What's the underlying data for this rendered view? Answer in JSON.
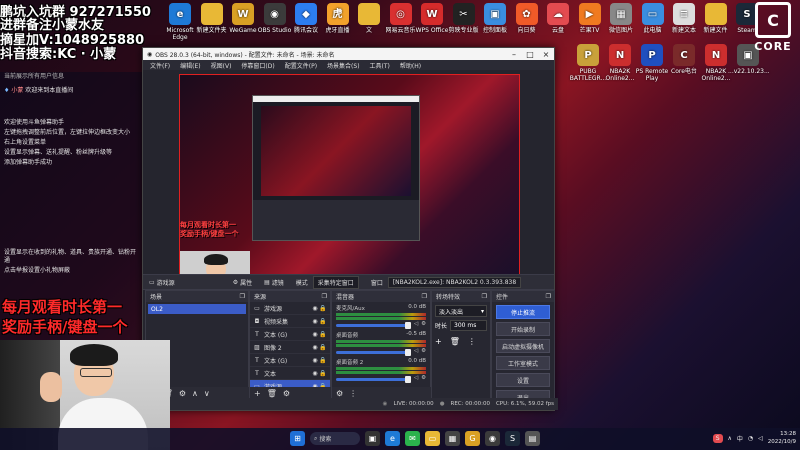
{
  "overlay": {
    "line1": "鹏坑入坑群 927271550",
    "line2": "进群备注小蒙水友",
    "line3": "摘星加V:1048925880",
    "line4": "抖音搜索:KC · 小蒙",
    "banner1": "每月观看时长第一",
    "banner2": "奖励手柄/键盘一个"
  },
  "chat": {
    "header": "当前展示所有用户信息",
    "welcome_user": "小蒙",
    "welcome_text": "欢迎来到本直播间",
    "lines": [
      "欢迎使用斗鱼弹幕助手",
      "左键拖拽调整前后位置，左键拉伸边框改变大小",
      "右上角设置菜单",
      "设置显示弹幕、送礼提醒、粉丝牌升级等",
      "添加弹幕助手成功"
    ],
    "lines2": [
      "设置显示在收到的礼物、道具、贵族开通、钻粉开通",
      "点击举报设置小礼物屏蔽"
    ]
  },
  "desktop_icons": [
    {
      "label": "Microsoft Edge",
      "icon": "edge-icon",
      "color": "#1e7ad6",
      "glyph": "e"
    },
    {
      "label": "新建文件夹",
      "icon": "folder-icon",
      "color": "#e8b836",
      "glyph": ""
    },
    {
      "label": "WeGame",
      "icon": "wegame-icon",
      "color": "#d9a024",
      "glyph": "W"
    },
    {
      "label": "OBS Studio",
      "icon": "obs-icon",
      "color": "#3b3b3b",
      "glyph": "◉"
    },
    {
      "label": "腾讯会议",
      "icon": "meeting-icon",
      "color": "#2c7df0",
      "glyph": "◆"
    },
    {
      "label": "虎牙直播",
      "icon": "huya-icon",
      "color": "#f2a22b",
      "glyph": "虎"
    },
    {
      "label": "文",
      "icon": "folder-icon",
      "color": "#e8b836",
      "glyph": ""
    },
    {
      "label": "网易云音乐",
      "icon": "music-icon",
      "color": "#d93030",
      "glyph": "◎"
    },
    {
      "label": "WPS Office",
      "icon": "wps-icon",
      "color": "#d62b2b",
      "glyph": "W"
    },
    {
      "label": "剪映专业版",
      "icon": "capcut-icon",
      "color": "#222222",
      "glyph": "✂"
    },
    {
      "label": "控制面板",
      "icon": "control-panel-icon",
      "color": "#3a8ee0",
      "glyph": "▣"
    },
    {
      "label": "向日葵",
      "icon": "sunflower-icon",
      "color": "#f05a28",
      "glyph": "✿"
    },
    {
      "label": "云盘",
      "icon": "cloud-icon",
      "color": "#e34b50",
      "glyph": "☁"
    },
    {
      "label": "芒果TV",
      "icon": "mango-icon",
      "color": "#f07a20",
      "glyph": "▶"
    },
    {
      "label": "微信图片",
      "icon": "image-icon",
      "color": "#888888",
      "glyph": "▦"
    },
    {
      "label": "此电脑",
      "icon": "computer-icon",
      "color": "#3a8ee0",
      "glyph": "▭"
    },
    {
      "label": "新建文本",
      "icon": "text-file-icon",
      "color": "#dddddd",
      "glyph": "≡"
    },
    {
      "label": "新建文件",
      "icon": "folder-icon",
      "color": "#e8b836",
      "glyph": ""
    },
    {
      "label": "Steam",
      "icon": "steam-icon",
      "color": "#1b2838",
      "glyph": "S"
    }
  ],
  "desktop_icons_row2": [
    {
      "label": "PUBG BATTLEGR...",
      "icon": "pubg-icon",
      "color": "#c9a13a",
      "glyph": "P"
    },
    {
      "label": "NBA2K Online2...",
      "icon": "nba-icon",
      "color": "#cc2e2e",
      "glyph": "N"
    },
    {
      "label": "PS Remote Play",
      "icon": "ps-icon",
      "color": "#1f4fbf",
      "glyph": "P"
    },
    {
      "label": "Core电台",
      "icon": "core-icon",
      "color": "#7a2a2a",
      "glyph": "C"
    },
    {
      "label": "NBA2K Online2...",
      "icon": "nba-icon",
      "color": "#cc2e2e",
      "glyph": "N"
    },
    {
      "label": "...v22.10.23...",
      "icon": "app-icon",
      "color": "#555555",
      "glyph": "▣"
    }
  ],
  "logo": {
    "text": "CORE"
  },
  "obs": {
    "title": "OBS 28.0.3 (64-bit, windows) - 配置文件: 未命名 - 场景: 未命名",
    "menu": [
      "文件(F)",
      "编辑(E)",
      "视图(V)",
      "停靠窗口(D)",
      "配置文件(P)",
      "场景集合(S)",
      "工具(T)",
      "帮助(H)"
    ],
    "source_bar": {
      "current_source": "游戏源",
      "properties": "属性",
      "filters": "滤镜",
      "mode_label": "模式",
      "mode_value": "采集特定窗口",
      "window_label": "窗口",
      "window_value": "[NBA2KOL2.exe]: NBA2KOL2 0.3.393.838"
    },
    "scenes": {
      "title": "场景",
      "items": [
        "OL2"
      ]
    },
    "sources": {
      "title": "来源",
      "items": [
        "游戏源",
        "视频采集",
        "文本 (G)",
        "图像 2",
        "文本 (G)",
        "文本",
        "游戏源"
      ]
    },
    "mixer": {
      "title": "混音器",
      "channels": [
        {
          "name": "麦克风/Aux",
          "db": "0.0 dB"
        },
        {
          "name": "桌面音频",
          "db": "-0.5 dB"
        },
        {
          "name": "桌面音频 2",
          "db": "0.0 dB"
        }
      ]
    },
    "transitions": {
      "title": "转场特效",
      "selected": "淡入淡出",
      "duration_label": "时长",
      "duration_value": "300 ms"
    },
    "controls": {
      "title": "控件",
      "buttons": [
        "停止推流",
        "开始录制",
        "启动虚拟摄像机",
        "工作室模式",
        "设置",
        "退出"
      ]
    },
    "status": {
      "live": "LIVE: 00:00:00",
      "rec": "REC: 00:00:00",
      "cpu": "CPU: 6.1%, 59.02 fps"
    }
  },
  "taskbar": {
    "search": "搜索",
    "tray_text": "中",
    "time": "13:28",
    "date": "2022/10/9"
  }
}
